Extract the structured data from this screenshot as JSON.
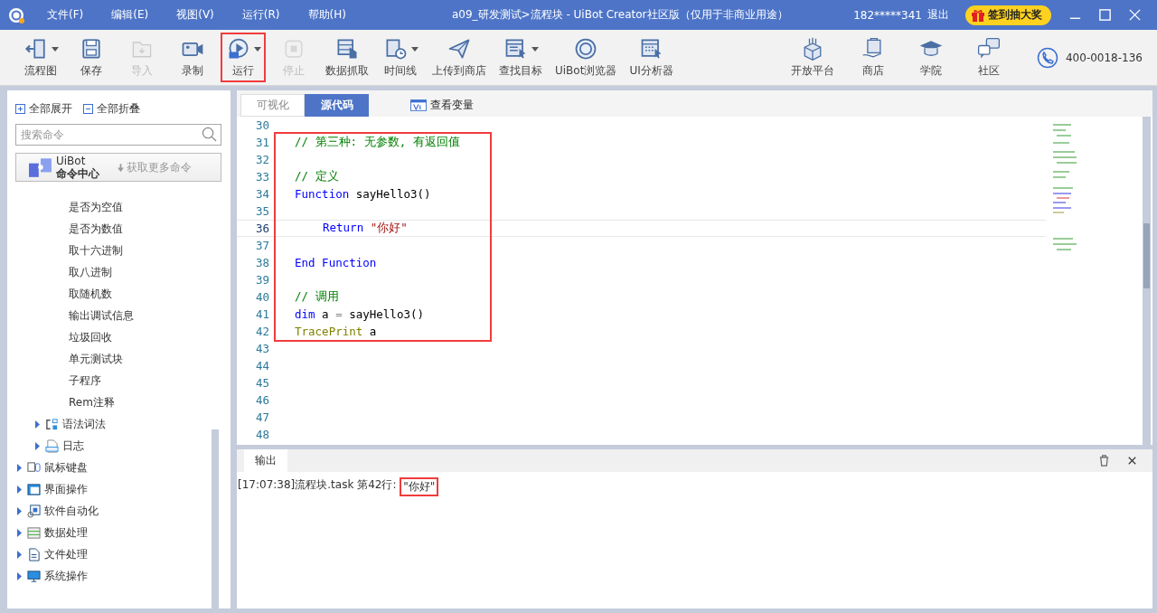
{
  "window": {
    "title": "a09_研发测试>流程块 - UiBot Creator社区版（仅用于非商业用途）",
    "menu": [
      "文件(F)",
      "编辑(E)",
      "视图(V)",
      "运行(R)",
      "帮助(H)"
    ],
    "user": "182*****341",
    "logout": "退出",
    "promo": "签到抽大奖"
  },
  "toolbar": {
    "items": [
      {
        "label": "流程图",
        "disabled": false,
        "dropdown": true,
        "highlighted": false
      },
      {
        "label": "保存",
        "disabled": false,
        "dropdown": false,
        "highlighted": false
      },
      {
        "label": "导入",
        "disabled": true,
        "dropdown": false,
        "highlighted": false
      },
      {
        "label": "录制",
        "disabled": false,
        "dropdown": false,
        "highlighted": false
      },
      {
        "label": "运行",
        "disabled": false,
        "dropdown": true,
        "highlighted": true
      },
      {
        "label": "停止",
        "disabled": true,
        "dropdown": false,
        "highlighted": false
      },
      {
        "label": "数据抓取",
        "disabled": false,
        "dropdown": false,
        "highlighted": false
      },
      {
        "label": "时间线",
        "disabled": false,
        "dropdown": true,
        "highlighted": false
      },
      {
        "label": "上传到商店",
        "disabled": false,
        "dropdown": false,
        "highlighted": false
      },
      {
        "label": "查找目标",
        "disabled": false,
        "dropdown": true,
        "highlighted": false
      },
      {
        "label": "UiBot浏览器",
        "disabled": false,
        "dropdown": false,
        "highlighted": false
      },
      {
        "label": "UI分析器",
        "disabled": false,
        "dropdown": false,
        "highlighted": false
      }
    ],
    "right_items": [
      {
        "label": "开放平台"
      },
      {
        "label": "商店"
      },
      {
        "label": "学院"
      },
      {
        "label": "社区"
      }
    ],
    "phone": "400-0018-136"
  },
  "sidebar": {
    "expand_all": "全部展开",
    "collapse_all": "全部折叠",
    "search": {
      "placeholder": "搜索命令"
    },
    "command_center": {
      "brand": "UiBot",
      "title": "命令中心",
      "more": "获取更多命令"
    },
    "tree": [
      {
        "children": [
          {
            "children": [
              {
                "label": "是否为空值"
              },
              {
                "label": "是否为数值"
              },
              {
                "label": "取十六进制"
              },
              {
                "label": "取八进制"
              },
              {
                "label": "取随机数"
              },
              {
                "label": "输出调试信息"
              },
              {
                "label": "垃圾回收"
              },
              {
                "label": "单元测试块"
              },
              {
                "label": "子程序"
              },
              {
                "label": "Rem注释"
              }
            ]
          },
          {
            "label": "语法词法",
            "expanded": false
          },
          {
            "label": "日志",
            "expanded": false
          }
        ]
      },
      {
        "label": "鼠标键盘",
        "expanded": false
      },
      {
        "label": "界面操作",
        "expanded": false
      },
      {
        "label": "软件自动化",
        "expanded": false
      },
      {
        "label": "数据处理",
        "expanded": false
      },
      {
        "label": "文件处理",
        "expanded": false
      },
      {
        "label": "系统操作",
        "expanded": false
      }
    ]
  },
  "editor": {
    "tabs": [
      {
        "label": "可视化",
        "selected": false
      },
      {
        "label": "源代码",
        "selected": true
      }
    ],
    "variables_button": "查看变量",
    "blocks": [
      {
        "highlighted": false,
        "lines": [
          {
            "number": "30",
            "current": false
          }
        ]
      },
      {
        "highlighted": true,
        "lines": [
          {
            "number": "31",
            "indented": false,
            "current": false,
            "tokens": [
              {
                "kind": "comment",
                "text": "// 第三种: 无参数, 有返回值"
              }
            ]
          },
          {
            "number": "32",
            "current": false
          },
          {
            "number": "33",
            "indented": false,
            "current": false,
            "tokens": [
              {
                "kind": "comment",
                "text": "// 定义"
              }
            ]
          },
          {
            "number": "34",
            "indented": false,
            "current": false,
            "tokens": [
              {
                "kind": "keyword",
                "text": "Function"
              },
              {
                "kind": "plain",
                "text": " sayHello3()"
              }
            ]
          },
          {
            "number": "35",
            "current": false
          },
          {
            "number": "36",
            "indented": true,
            "current": true,
            "tokens": [
              {
                "kind": "keyword",
                "text": "Return"
              },
              {
                "kind": "string",
                "text": " \"你好\""
              }
            ]
          },
          {
            "number": "37",
            "current": false
          },
          {
            "number": "38",
            "indented": false,
            "current": false,
            "tokens": [
              {
                "kind": "keyword",
                "text": "End Function"
              }
            ]
          },
          {
            "number": "39",
            "current": false
          },
          {
            "number": "40",
            "indented": false,
            "current": false,
            "tokens": [
              {
                "kind": "comment",
                "text": "// 调用"
              }
            ]
          },
          {
            "number": "41",
            "indented": false,
            "current": false,
            "tokens": [
              {
                "kind": "keyword",
                "text": "dim"
              },
              {
                "kind": "plain",
                "text": " a "
              },
              {
                "kind": "operator",
                "text": "="
              },
              {
                "kind": "plain",
                "text": " sayHello3()"
              }
            ]
          },
          {
            "number": "42",
            "indented": false,
            "current": false,
            "tokens": [
              {
                "kind": "builtin",
                "text": "TracePrint"
              },
              {
                "kind": "plain",
                "text": " a"
              }
            ]
          }
        ]
      },
      {
        "highlighted": false,
        "lines": [
          {
            "number": "43",
            "current": false
          },
          {
            "number": "44",
            "current": false
          },
          {
            "number": "45",
            "current": false
          },
          {
            "number": "46",
            "current": false
          },
          {
            "number": "47",
            "current": false
          },
          {
            "number": "48",
            "current": false
          }
        ]
      }
    ]
  },
  "output": {
    "tab": "输出",
    "lines": [
      {
        "segments": [
          {
            "text": "[17:07:38]流程块.task 第42行: ",
            "highlighted": false
          },
          {
            "text": "\"你好\"",
            "highlighted": true
          }
        ]
      }
    ]
  }
}
